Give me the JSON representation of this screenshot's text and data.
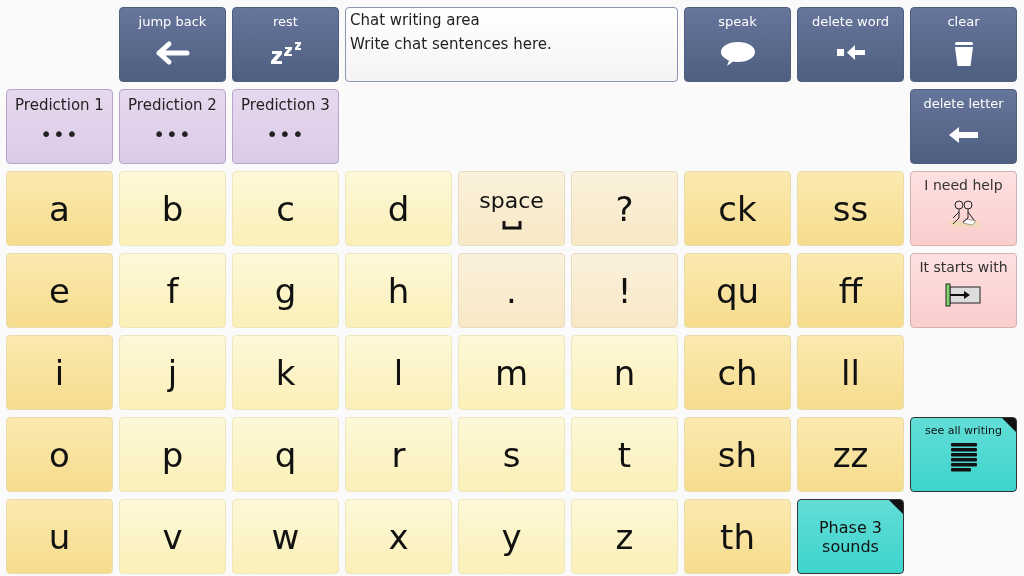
{
  "rows": [
    [
      {
        "kind": "blank"
      },
      {
        "kind": "nav",
        "label": "jump back"
      },
      {
        "kind": "nav",
        "label": "rest"
      },
      {
        "kind": "chat",
        "title": "Chat writing area",
        "placeholder": "Write chat sentences here."
      },
      {
        "kind": "nav",
        "label": "speak"
      },
      {
        "kind": "nav",
        "label": "delete word"
      },
      {
        "kind": "nav",
        "label": "clear"
      }
    ],
    [
      {
        "kind": "prediction",
        "label": "Prediction 1",
        "symbol": "•••"
      },
      {
        "kind": "prediction",
        "label": "Prediction 2",
        "symbol": "•••"
      },
      {
        "kind": "prediction",
        "label": "Prediction 3",
        "symbol": "•••"
      },
      {
        "kind": "blank"
      },
      {
        "kind": "blank"
      },
      {
        "kind": "blank"
      },
      {
        "kind": "blank"
      },
      {
        "kind": "blank"
      },
      {
        "kind": "nav",
        "label": "delete letter"
      }
    ],
    [
      {
        "kind": "vowel",
        "label": "a"
      },
      {
        "kind": "letter",
        "label": "b"
      },
      {
        "kind": "letter",
        "label": "c"
      },
      {
        "kind": "letter",
        "label": "d"
      },
      {
        "kind": "space",
        "label": "space"
      },
      {
        "kind": "punct",
        "label": "?"
      },
      {
        "kind": "digraph",
        "label": "ck"
      },
      {
        "kind": "digraph",
        "label": "ss"
      },
      {
        "kind": "help",
        "label": "I need help"
      }
    ],
    [
      {
        "kind": "vowel",
        "label": "e"
      },
      {
        "kind": "letter",
        "label": "f"
      },
      {
        "kind": "letter",
        "label": "g"
      },
      {
        "kind": "letter",
        "label": "h"
      },
      {
        "kind": "punct",
        "label": "."
      },
      {
        "kind": "punct",
        "label": "!"
      },
      {
        "kind": "digraph",
        "label": "qu"
      },
      {
        "kind": "digraph",
        "label": "ff"
      },
      {
        "kind": "help",
        "label": "It starts with"
      }
    ],
    [
      {
        "kind": "vowel",
        "label": "i"
      },
      {
        "kind": "letter",
        "label": "j"
      },
      {
        "kind": "letter",
        "label": "k"
      },
      {
        "kind": "letter",
        "label": "l"
      },
      {
        "kind": "letter",
        "label": "m"
      },
      {
        "kind": "letter",
        "label": "n"
      },
      {
        "kind": "digraph",
        "label": "ch"
      },
      {
        "kind": "digraph",
        "label": "ll"
      },
      {
        "kind": "blank"
      }
    ],
    [
      {
        "kind": "vowel",
        "label": "o"
      },
      {
        "kind": "letter",
        "label": "p"
      },
      {
        "kind": "letter",
        "label": "q"
      },
      {
        "kind": "letter",
        "label": "r"
      },
      {
        "kind": "letter",
        "label": "s"
      },
      {
        "kind": "letter",
        "label": "t"
      },
      {
        "kind": "digraph",
        "label": "sh"
      },
      {
        "kind": "digraph",
        "label": "zz"
      },
      {
        "kind": "viewer",
        "label": "see all writing"
      }
    ],
    [
      {
        "kind": "vowel",
        "label": "u"
      },
      {
        "kind": "letter",
        "label": "v"
      },
      {
        "kind": "letter",
        "label": "w"
      },
      {
        "kind": "letter",
        "label": "x"
      },
      {
        "kind": "letter",
        "label": "y"
      },
      {
        "kind": "letter",
        "label": "z"
      },
      {
        "kind": "digraph",
        "label": "th"
      },
      {
        "kind": "link",
        "label": "Phase 3 sounds"
      },
      {
        "kind": "blank"
      }
    ]
  ]
}
